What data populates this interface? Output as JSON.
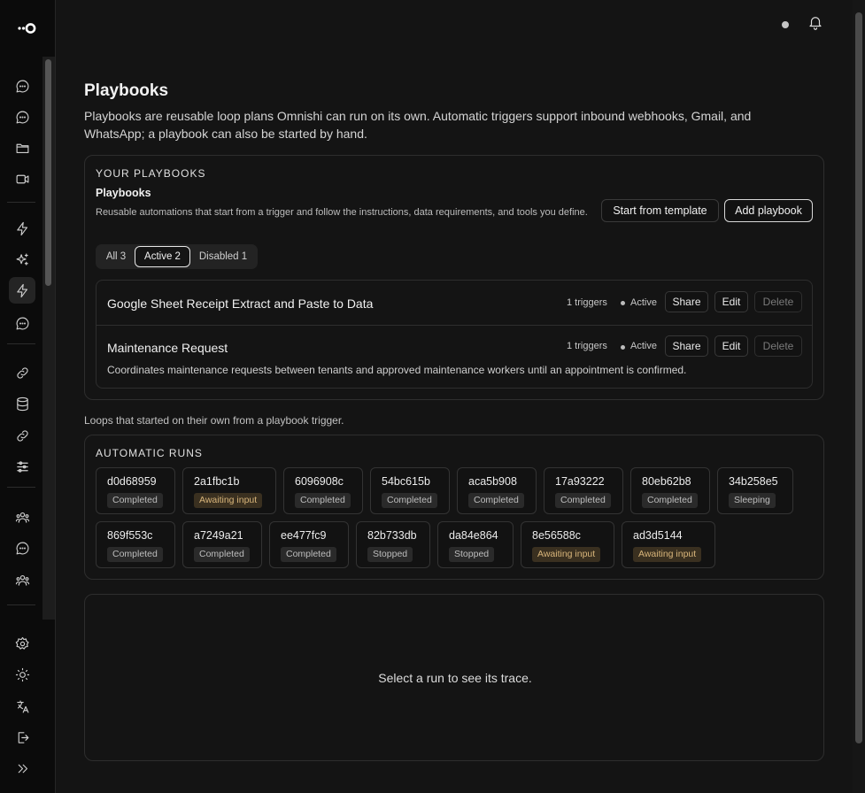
{
  "sidebar": {
    "logo_icon": "omnishi-logo",
    "nav_top": [
      {
        "icon": "chat-bubble-icon"
      },
      {
        "icon": "chat-bubble-icon"
      },
      {
        "icon": "folder-icon"
      },
      {
        "icon": "video-icon"
      }
    ],
    "nav_mid": [
      {
        "icon": "lightning-icon"
      },
      {
        "icon": "sparkles-icon"
      },
      {
        "icon": "lightning-icon",
        "active": true
      },
      {
        "icon": "chat-bubble-icon"
      }
    ],
    "nav_low": [
      {
        "icon": "link-icon"
      },
      {
        "icon": "database-icon"
      },
      {
        "icon": "link-icon"
      },
      {
        "icon": "sliders-icon"
      }
    ],
    "nav_bottom": [
      {
        "icon": "users-icon"
      },
      {
        "icon": "chat-bubble-icon"
      },
      {
        "icon": "users-icon"
      }
    ],
    "footer": [
      {
        "icon": "gear-icon"
      },
      {
        "icon": "sun-icon"
      },
      {
        "icon": "translate-icon"
      },
      {
        "icon": "logout-icon"
      },
      {
        "icon": "chevrons-right-icon"
      }
    ]
  },
  "topbar": {
    "status_icon": "status-dot-icon",
    "bell_icon": "bell-icon"
  },
  "page": {
    "title": "Playbooks",
    "description": "Playbooks are reusable loop plans Omnishi can run on its own. Automatic triggers support inbound webhooks, Gmail, and WhatsApp; a playbook can also be started by hand."
  },
  "playbooks_card": {
    "section_label": "YOUR PLAYBOOKS",
    "subtitle": "Playbooks",
    "subdescription": "Reusable automations that start from a trigger and follow the instructions, data requirements, and tools you define.",
    "template_button": "Start from template",
    "add_button": "Add playbook",
    "filters": [
      {
        "label": "All 3",
        "selected": false
      },
      {
        "label": "Active 2",
        "selected": true
      },
      {
        "label": "Disabled 1",
        "selected": false
      }
    ],
    "rows": [
      {
        "title": "Google Sheet Receipt Extract and Paste to Data",
        "description": "",
        "triggers": "1 triggers",
        "status": "Active",
        "share": "Share",
        "edit": "Edit",
        "delete": "Delete"
      },
      {
        "title": "Maintenance Request",
        "description": "Coordinates maintenance requests between tenants and approved maintenance workers until an appointment is confirmed.",
        "triggers": "1 triggers",
        "status": "Active",
        "share": "Share",
        "edit": "Edit",
        "delete": "Delete"
      }
    ]
  },
  "runs_note": "Loops that started on their own from a playbook trigger.",
  "runs_card": {
    "section_label": "AUTOMATIC RUNS",
    "runs": [
      {
        "id": "d0d68959",
        "status": "Completed"
      },
      {
        "id": "2a1fbc1b",
        "status": "Awaiting input"
      },
      {
        "id": "6096908c",
        "status": "Completed"
      },
      {
        "id": "54bc615b",
        "status": "Completed"
      },
      {
        "id": "aca5b908",
        "status": "Completed"
      },
      {
        "id": "17a93222",
        "status": "Completed"
      },
      {
        "id": "80eb62b8",
        "status": "Completed"
      },
      {
        "id": "34b258e5",
        "status": "Sleeping"
      },
      {
        "id": "869f553c",
        "status": "Completed"
      },
      {
        "id": "a7249a21",
        "status": "Completed"
      },
      {
        "id": "ee477fc9",
        "status": "Completed"
      },
      {
        "id": "82b733db",
        "status": "Stopped"
      },
      {
        "id": "da84e864",
        "status": "Stopped"
      },
      {
        "id": "8e56588c",
        "status": "Awaiting input"
      },
      {
        "id": "ad3d5144",
        "status": "Awaiting input"
      }
    ]
  },
  "trace_card": {
    "empty_message": "Select a run to see its trace."
  },
  "colors": {
    "background": "#141414",
    "sidebar": "#0b0b0b",
    "border": "#2e2e2e",
    "awaiting_badge": "#d8b57a"
  }
}
